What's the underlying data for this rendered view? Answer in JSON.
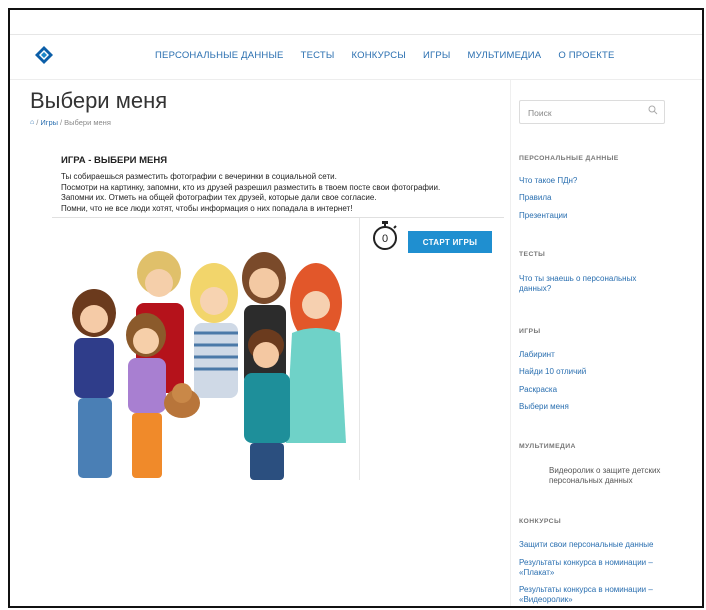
{
  "header": {
    "nav": [
      "ПЕРСОНАЛЬНЫЕ ДАННЫЕ",
      "ТЕСТЫ",
      "КОНКУРСЫ",
      "ИГРЫ",
      "МУЛЬТИМЕДИА",
      "О ПРОЕКТЕ"
    ]
  },
  "page": {
    "title": "Выбери меня",
    "breadcrumb": [
      "Игры",
      "Выбери меня"
    ],
    "separator": "/"
  },
  "game": {
    "title": "ИГРА - ВЫБЕРИ МЕНЯ",
    "text": [
      "Ты собираешься разместить фотографии с вечеринки в социальной сети.",
      "Посмотри на картинку, запомни, кто из друзей разрешил разместить в твоем посте свои фотографии.",
      "Запомни их. Отметь на общей фотографии тех друзей, которые дали свое согласие.",
      "Помни, что не все люди хотят, чтобы информация о них попадала в интернет!"
    ],
    "timer_value": "0",
    "start_label": "СТАРТ ИГРЫ"
  },
  "sidebar": {
    "search_placeholder": "Поиск",
    "sections": [
      {
        "title": "ПЕРСОНАЛЬНЫЕ ДАННЫЕ",
        "links": [
          "Что такое ПДн?",
          "Правила",
          "Презентации"
        ]
      },
      {
        "title": "ТЕСТЫ",
        "links": [
          "Что ты знаешь о персональных данных?"
        ]
      },
      {
        "title": "ИГРЫ",
        "links": [
          "Лабиринт",
          "Найди 10 отличий",
          "Раскраска",
          "Выбери меня"
        ]
      },
      {
        "title": "МУЛЬТИМЕДИА",
        "links": [
          "Видеоролик о защите детских персональных данных"
        ]
      },
      {
        "title": "КОНКУРСЫ",
        "links": [
          "Защити свои персональные данные",
          "Результаты конкурса в номинации – «Плакат»",
          "Результаты конкурса в номинации – «Видеоролик»"
        ]
      }
    ]
  },
  "colors": {
    "link": "#2a6fb0",
    "button": "#1f8fd0",
    "text": "#222222",
    "muted": "#777777"
  },
  "icons": [
    "logo-icon",
    "home-icon",
    "search-icon",
    "timer-icon"
  ]
}
